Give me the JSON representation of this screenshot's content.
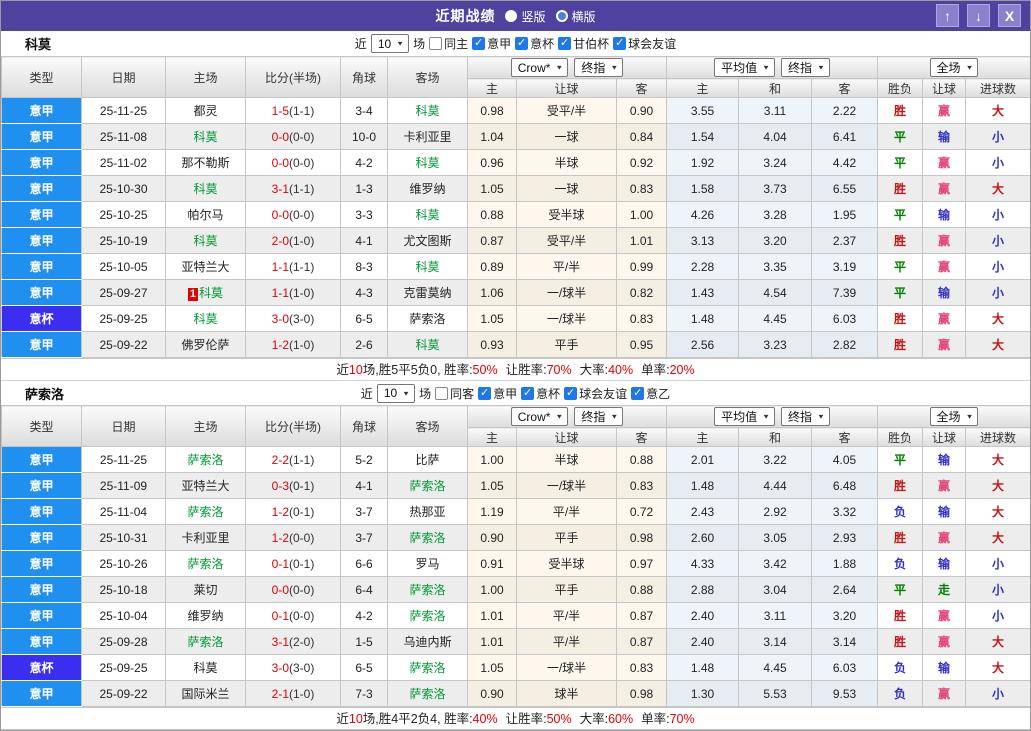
{
  "header": {
    "title": "近期战绩",
    "modes": [
      {
        "label": "竖版",
        "selected": true
      },
      {
        "label": "横版",
        "selected": false
      }
    ],
    "buttons": {
      "up": "↑",
      "down": "↓",
      "close": "X"
    }
  },
  "colors": {
    "header_bg": "#4e429e",
    "serie_a_blue": "#2090f0",
    "coppa_blue": "#3c2ef0",
    "team_green": "#009933",
    "score_red": "#e60000",
    "win_red": "#c41414",
    "handicap_win_pink": "#e8457e",
    "draw_green": "#008000",
    "lose_blue": "#3030cc"
  },
  "sections": [
    {
      "team": "科莫",
      "filter": {
        "near": "近",
        "count": "10",
        "unit": "场",
        "same": {
          "label": "同主",
          "checked": false
        },
        "leagues": [
          {
            "label": "意甲",
            "checked": true
          },
          {
            "label": "意杯",
            "checked": true
          },
          {
            "label": "甘伯杯",
            "checked": true
          },
          {
            "label": "球会友谊",
            "checked": true
          }
        ]
      },
      "table": {
        "static_cols": [
          "类型",
          "日期",
          "主场",
          "比分(半场)",
          "角球",
          "客场"
        ],
        "selects": {
          "crow": "Crow*",
          "crow_ref": "终指",
          "avg": "平均值",
          "avg_ref": "终指",
          "full": "全场"
        },
        "crow_cols": [
          "主",
          "让球",
          "客"
        ],
        "avg_cols": [
          "主",
          "和",
          "客"
        ],
        "full_cols": [
          "胜负",
          "让球",
          "进球数"
        ],
        "rows": [
          {
            "t": "意甲",
            "ts": "jia",
            "d": "25-11-25",
            "h": "都灵",
            "hs": "",
            "hb": "",
            "sc": "1-5",
            "ht": "(1-1)",
            "cn": "3-4",
            "a": "科莫",
            "as": "green",
            "o1": "0.98",
            "hc": "受平/半",
            "o2": "0.90",
            "e1": "3.55",
            "e2": "3.11",
            "e3": "2.22",
            "r1": "胜",
            "r1s": "red",
            "r2": "赢",
            "r2s": "pink",
            "r3": "大",
            "r3s": "red"
          },
          {
            "t": "意甲",
            "ts": "jia",
            "d": "25-11-08",
            "h": "科莫",
            "hs": "green",
            "hb": "",
            "sc": "0-0",
            "ht": "(0-0)",
            "cn": "10-0",
            "a": "卡利亚里",
            "as": "",
            "o1": "1.04",
            "hc": "一球",
            "o2": "0.84",
            "e1": "1.54",
            "e2": "4.04",
            "e3": "6.41",
            "r1": "平",
            "r1s": "grn",
            "r2": "输",
            "r2s": "blu",
            "r3": "小",
            "r3s": "blu"
          },
          {
            "t": "意甲",
            "ts": "jia",
            "d": "25-11-02",
            "h": "那不勒斯",
            "hs": "",
            "hb": "",
            "sc": "0-0",
            "ht": "(0-0)",
            "cn": "4-2",
            "a": "科莫",
            "as": "green",
            "o1": "0.96",
            "hc": "半球",
            "o2": "0.92",
            "e1": "1.92",
            "e2": "3.24",
            "e3": "4.42",
            "r1": "平",
            "r1s": "grn",
            "r2": "赢",
            "r2s": "pink",
            "r3": "小",
            "r3s": "blu"
          },
          {
            "t": "意甲",
            "ts": "jia",
            "d": "25-10-30",
            "h": "科莫",
            "hs": "green",
            "hb": "",
            "sc": "3-1",
            "ht": "(1-1)",
            "cn": "1-3",
            "a": "维罗纳",
            "as": "",
            "o1": "1.05",
            "hc": "一球",
            "o2": "0.83",
            "e1": "1.58",
            "e2": "3.73",
            "e3": "6.55",
            "r1": "胜",
            "r1s": "red",
            "r2": "赢",
            "r2s": "pink",
            "r3": "大",
            "r3s": "red"
          },
          {
            "t": "意甲",
            "ts": "jia",
            "d": "25-10-25",
            "h": "帕尔马",
            "hs": "",
            "hb": "",
            "sc": "0-0",
            "ht": "(0-0)",
            "cn": "3-3",
            "a": "科莫",
            "as": "green",
            "o1": "0.88",
            "hc": "受半球",
            "o2": "1.00",
            "e1": "4.26",
            "e2": "3.28",
            "e3": "1.95",
            "r1": "平",
            "r1s": "grn",
            "r2": "输",
            "r2s": "blu",
            "r3": "小",
            "r3s": "blu"
          },
          {
            "t": "意甲",
            "ts": "jia",
            "d": "25-10-19",
            "h": "科莫",
            "hs": "green",
            "hb": "",
            "sc": "2-0",
            "ht": "(1-0)",
            "cn": "4-1",
            "a": "尤文图斯",
            "as": "",
            "o1": "0.87",
            "hc": "受平/半",
            "o2": "1.01",
            "e1": "3.13",
            "e2": "3.20",
            "e3": "2.37",
            "r1": "胜",
            "r1s": "red",
            "r2": "赢",
            "r2s": "pink",
            "r3": "小",
            "r3s": "blu"
          },
          {
            "t": "意甲",
            "ts": "jia",
            "d": "25-10-05",
            "h": "亚特兰大",
            "hs": "",
            "hb": "",
            "sc": "1-1",
            "ht": "(1-1)",
            "cn": "8-3",
            "a": "科莫",
            "as": "green",
            "o1": "0.89",
            "hc": "平/半",
            "o2": "0.99",
            "e1": "2.28",
            "e2": "3.35",
            "e3": "3.19",
            "r1": "平",
            "r1s": "grn",
            "r2": "赢",
            "r2s": "pink",
            "r3": "小",
            "r3s": "blu"
          },
          {
            "t": "意甲",
            "ts": "jia",
            "d": "25-09-27",
            "h": "科莫",
            "hs": "green",
            "hb": "1",
            "sc": "1-1",
            "ht": "(1-0)",
            "cn": "4-3",
            "a": "克雷莫纳",
            "as": "",
            "o1": "1.06",
            "hc": "一/球半",
            "o2": "0.82",
            "e1": "1.43",
            "e2": "4.54",
            "e3": "7.39",
            "r1": "平",
            "r1s": "grn",
            "r2": "输",
            "r2s": "blu",
            "r3": "小",
            "r3s": "blu"
          },
          {
            "t": "意杯",
            "ts": "bei",
            "d": "25-09-25",
            "h": "科莫",
            "hs": "green",
            "hb": "",
            "sc": "3-0",
            "ht": "(3-0)",
            "cn": "6-5",
            "a": "萨索洛",
            "as": "",
            "o1": "1.05",
            "hc": "一/球半",
            "o2": "0.83",
            "e1": "1.48",
            "e2": "4.45",
            "e3": "6.03",
            "r1": "胜",
            "r1s": "red",
            "r2": "赢",
            "r2s": "pink",
            "r3": "大",
            "r3s": "red"
          },
          {
            "t": "意甲",
            "ts": "jia",
            "d": "25-09-22",
            "h": "佛罗伦萨",
            "hs": "",
            "hb": "",
            "sc": "1-2",
            "ht": "(1-0)",
            "cn": "2-6",
            "a": "科莫",
            "as": "green",
            "o1": "0.93",
            "hc": "平手",
            "o2": "0.95",
            "e1": "2.56",
            "e2": "3.23",
            "e3": "2.82",
            "r1": "胜",
            "r1s": "red",
            "r2": "赢",
            "r2s": "pink",
            "r3": "大",
            "r3s": "red"
          }
        ]
      },
      "summary": {
        "s1": "近",
        "n": "10",
        "s2": "场,胜5平5负0, 胜率:",
        "v1": "50%",
        "s3": "让胜率:",
        "v2": "70%",
        "s4": "大率:",
        "v3": "40%",
        "s5": "单率:",
        "v4": "20%"
      }
    },
    {
      "team": "萨索洛",
      "filter": {
        "near": "近",
        "count": "10",
        "unit": "场",
        "same": {
          "label": "同客",
          "checked": false
        },
        "leagues": [
          {
            "label": "意甲",
            "checked": true
          },
          {
            "label": "意杯",
            "checked": true
          },
          {
            "label": "球会友谊",
            "checked": true
          },
          {
            "label": "意乙",
            "checked": true
          }
        ]
      },
      "table": {
        "static_cols": [
          "类型",
          "日期",
          "主场",
          "比分(半场)",
          "角球",
          "客场"
        ],
        "selects": {
          "crow": "Crow*",
          "crow_ref": "终指",
          "avg": "平均值",
          "avg_ref": "终指",
          "full": "全场"
        },
        "crow_cols": [
          "主",
          "让球",
          "客"
        ],
        "avg_cols": [
          "主",
          "和",
          "客"
        ],
        "full_cols": [
          "胜负",
          "让球",
          "进球数"
        ],
        "rows": [
          {
            "t": "意甲",
            "ts": "jia",
            "d": "25-11-25",
            "h": "萨索洛",
            "hs": "green",
            "hb": "",
            "sc": "2-2",
            "ht": "(1-1)",
            "cn": "5-2",
            "a": "比萨",
            "as": "",
            "o1": "1.00",
            "hc": "半球",
            "o2": "0.88",
            "e1": "2.01",
            "e2": "3.22",
            "e3": "4.05",
            "r1": "平",
            "r1s": "grn",
            "r2": "输",
            "r2s": "blu",
            "r3": "大",
            "r3s": "red"
          },
          {
            "t": "意甲",
            "ts": "jia",
            "d": "25-11-09",
            "h": "亚特兰大",
            "hs": "",
            "hb": "",
            "sc": "0-3",
            "ht": "(0-1)",
            "cn": "4-1",
            "a": "萨索洛",
            "as": "green",
            "o1": "1.05",
            "hc": "一/球半",
            "o2": "0.83",
            "e1": "1.48",
            "e2": "4.44",
            "e3": "6.48",
            "r1": "胜",
            "r1s": "red",
            "r2": "赢",
            "r2s": "pink",
            "r3": "大",
            "r3s": "red"
          },
          {
            "t": "意甲",
            "ts": "jia",
            "d": "25-11-04",
            "h": "萨索洛",
            "hs": "green",
            "hb": "",
            "sc": "1-2",
            "ht": "(0-1)",
            "cn": "3-7",
            "a": "热那亚",
            "as": "",
            "o1": "1.19",
            "hc": "平/半",
            "o2": "0.72",
            "e1": "2.43",
            "e2": "2.92",
            "e3": "3.32",
            "r1": "负",
            "r1s": "blu",
            "r2": "输",
            "r2s": "blu",
            "r3": "大",
            "r3s": "red"
          },
          {
            "t": "意甲",
            "ts": "jia",
            "d": "25-10-31",
            "h": "卡利亚里",
            "hs": "",
            "hb": "",
            "sc": "1-2",
            "ht": "(0-0)",
            "cn": "3-7",
            "a": "萨索洛",
            "as": "green",
            "o1": "0.90",
            "hc": "平手",
            "o2": "0.98",
            "e1": "2.60",
            "e2": "3.05",
            "e3": "2.93",
            "r1": "胜",
            "r1s": "red",
            "r2": "赢",
            "r2s": "pink",
            "r3": "大",
            "r3s": "red"
          },
          {
            "t": "意甲",
            "ts": "jia",
            "d": "25-10-26",
            "h": "萨索洛",
            "hs": "green",
            "hb": "",
            "sc": "0-1",
            "ht": "(0-1)",
            "cn": "6-6",
            "a": "罗马",
            "as": "",
            "o1": "0.91",
            "hc": "受半球",
            "o2": "0.97",
            "e1": "4.33",
            "e2": "3.42",
            "e3": "1.88",
            "r1": "负",
            "r1s": "blu",
            "r2": "输",
            "r2s": "blu",
            "r3": "小",
            "r3s": "blu"
          },
          {
            "t": "意甲",
            "ts": "jia",
            "d": "25-10-18",
            "h": "莱切",
            "hs": "",
            "hb": "",
            "sc": "0-0",
            "ht": "(0-0)",
            "cn": "6-4",
            "a": "萨索洛",
            "as": "green",
            "o1": "1.00",
            "hc": "平手",
            "o2": "0.88",
            "e1": "2.88",
            "e2": "3.04",
            "e3": "2.64",
            "r1": "平",
            "r1s": "grn",
            "r2": "走",
            "r2s": "grn",
            "r3": "小",
            "r3s": "blu"
          },
          {
            "t": "意甲",
            "ts": "jia",
            "d": "25-10-04",
            "h": "维罗纳",
            "hs": "",
            "hb": "",
            "sc": "0-1",
            "ht": "(0-0)",
            "cn": "4-2",
            "a": "萨索洛",
            "as": "green",
            "o1": "1.01",
            "hc": "平/半",
            "o2": "0.87",
            "e1": "2.40",
            "e2": "3.11",
            "e3": "3.20",
            "r1": "胜",
            "r1s": "red",
            "r2": "赢",
            "r2s": "pink",
            "r3": "小",
            "r3s": "blu"
          },
          {
            "t": "意甲",
            "ts": "jia",
            "d": "25-09-28",
            "h": "萨索洛",
            "hs": "green",
            "hb": "",
            "sc": "3-1",
            "ht": "(2-0)",
            "cn": "1-5",
            "a": "乌迪内斯",
            "as": "",
            "o1": "1.01",
            "hc": "平/半",
            "o2": "0.87",
            "e1": "2.40",
            "e2": "3.14",
            "e3": "3.14",
            "r1": "胜",
            "r1s": "red",
            "r2": "赢",
            "r2s": "pink",
            "r3": "大",
            "r3s": "red"
          },
          {
            "t": "意杯",
            "ts": "bei",
            "d": "25-09-25",
            "h": "科莫",
            "hs": "",
            "hb": "",
            "sc": "3-0",
            "ht": "(3-0)",
            "cn": "6-5",
            "a": "萨索洛",
            "as": "green",
            "o1": "1.05",
            "hc": "一/球半",
            "o2": "0.83",
            "e1": "1.48",
            "e2": "4.45",
            "e3": "6.03",
            "r1": "负",
            "r1s": "blu",
            "r2": "输",
            "r2s": "blu",
            "r3": "大",
            "r3s": "red"
          },
          {
            "t": "意甲",
            "ts": "jia",
            "d": "25-09-22",
            "h": "国际米兰",
            "hs": "",
            "hb": "",
            "sc": "2-1",
            "ht": "(1-0)",
            "cn": "7-3",
            "a": "萨索洛",
            "as": "green",
            "o1": "0.90",
            "hc": "球半",
            "o2": "0.98",
            "e1": "1.30",
            "e2": "5.53",
            "e3": "9.53",
            "r1": "负",
            "r1s": "blu",
            "r2": "赢",
            "r2s": "pink",
            "r3": "小",
            "r3s": "blu"
          }
        ]
      },
      "summary": {
        "s1": "近",
        "n": "10",
        "s2": "场,胜4平2负4, 胜率:",
        "v1": "40%",
        "s3": "让胜率:",
        "v2": "50%",
        "s4": "大率:",
        "v3": "60%",
        "s5": "单率:",
        "v4": "70%"
      }
    }
  ]
}
